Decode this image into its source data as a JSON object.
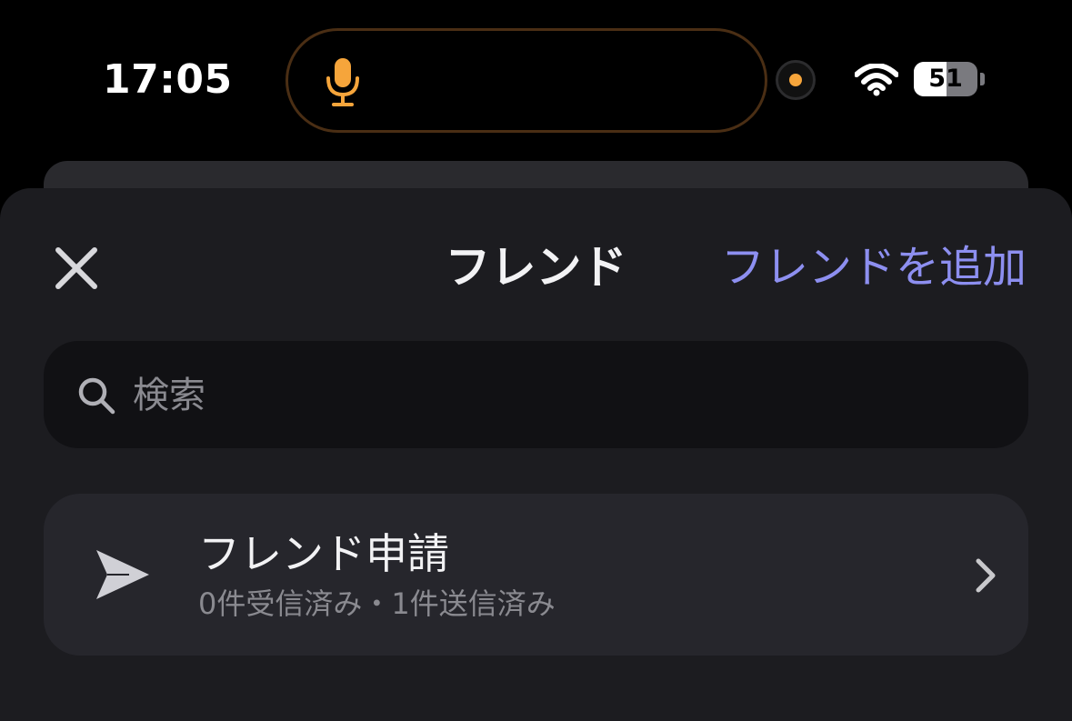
{
  "status_bar": {
    "time": "17:05",
    "battery_level": "51",
    "battery_fraction": 0.51,
    "icons": [
      "microphone-icon",
      "camera-indicator",
      "wifi-icon",
      "battery-icon"
    ]
  },
  "header": {
    "title": "フレンド",
    "add_friend_label": "フレンドを追加",
    "close_icon": "close-icon"
  },
  "search": {
    "placeholder": "検索",
    "value": "",
    "icon": "search-icon"
  },
  "friend_requests": {
    "title": "フレンド申請",
    "subtitle": "0件受信済み・1件送信済み",
    "icon": "send-icon",
    "chevron": "chevron-right-icon"
  },
  "colors": {
    "accent": "#8d8ff0",
    "sheet_background": "#1c1c20",
    "card_background": "#26262c",
    "mic_orange": "#f6a53b"
  }
}
